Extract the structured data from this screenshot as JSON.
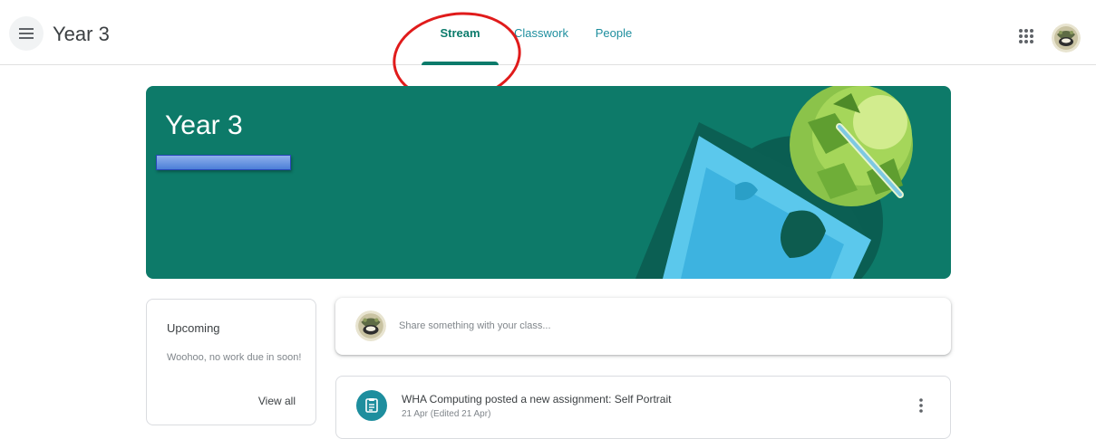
{
  "header": {
    "class_title": "Year 3",
    "tabs": [
      {
        "label": "Stream",
        "active": true
      },
      {
        "label": "Classwork",
        "active": false
      },
      {
        "label": "People",
        "active": false
      }
    ],
    "icons": {
      "menu": "hamburger-menu-icon",
      "apps": "apps-grid-icon"
    }
  },
  "banner": {
    "title": "Year 3",
    "color": "#0d7a69"
  },
  "upcoming": {
    "title": "Upcoming",
    "message": "Woohoo, no work due in soon!",
    "link": "View all"
  },
  "share": {
    "placeholder": "Share something with your class..."
  },
  "post": {
    "title": "WHA Computing posted a new assignment: Self Portrait",
    "date": "21 Apr (Edited 21 Apr)",
    "icon": "assignment-icon"
  },
  "colors": {
    "accent": "#0b7b6b",
    "tab_text": "#1e8e9e",
    "annotation": "#e01b1b"
  }
}
